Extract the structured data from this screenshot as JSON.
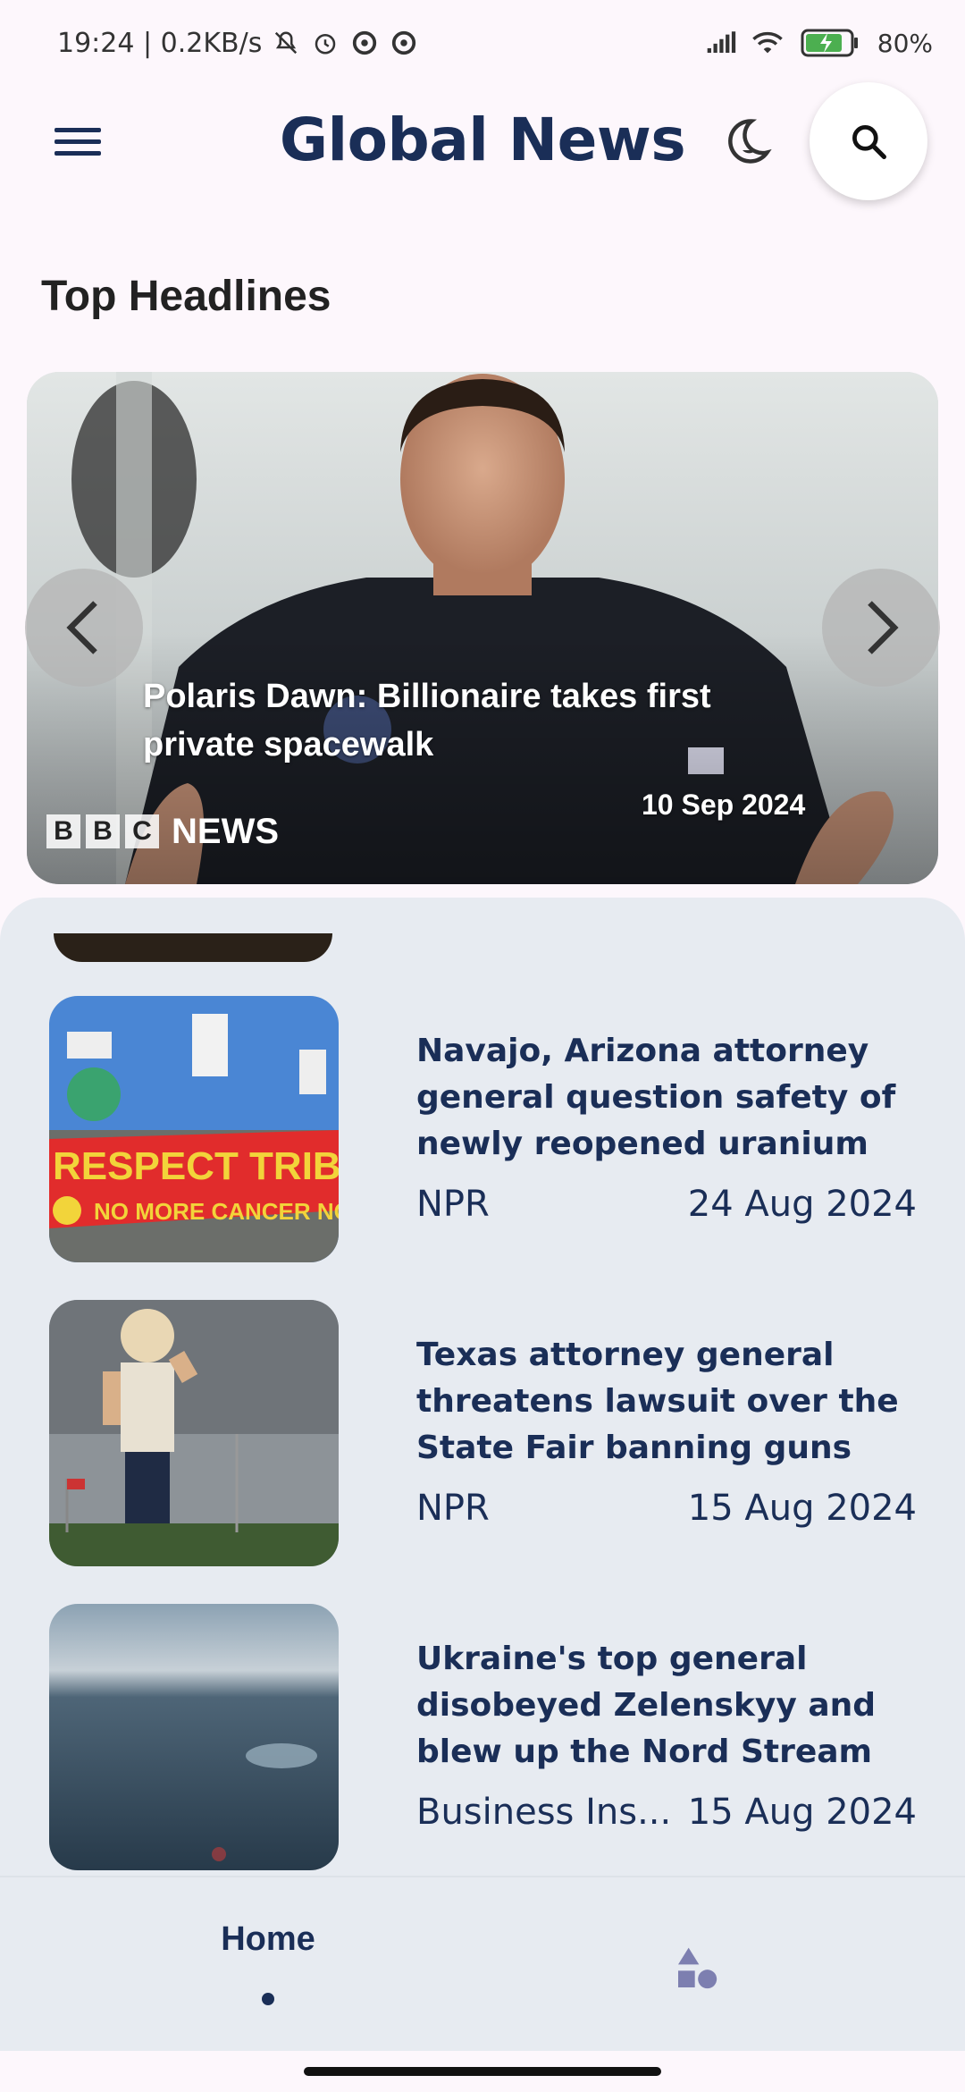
{
  "status_bar": {
    "time_speed": "19:24 | 0.2KB/s",
    "battery": "80%"
  },
  "app_bar": {
    "title": "Global News"
  },
  "section": {
    "title": "Top Headlines"
  },
  "carousel": {
    "headline": "Polaris Dawn: Billionaire takes first private spacewalk",
    "source_letters": [
      "B",
      "B",
      "C"
    ],
    "source_word": "NEWS",
    "date": "10 Sep 2024"
  },
  "articles": [
    {
      "title": "Navajo, Arizona attorney general question safety of newly reopened uranium",
      "source": "NPR",
      "date": "24 Aug 2024",
      "image_sign": "RESPECT TRIBAL SOVE",
      "image_sign2": "NO MORE CANCER NO MORE"
    },
    {
      "title": "Texas attorney general threatens lawsuit over the State Fair banning guns",
      "source": "NPR",
      "date": "15 Aug 2024"
    },
    {
      "title": "Ukraine's top general disobeyed Zelenskyy and blew up the Nord Stream",
      "source": "Business Ins...",
      "date": "15 Aug 2024"
    }
  ],
  "bottom_nav": {
    "home_label": "Home"
  },
  "colors": {
    "primary": "#1a2e57",
    "background": "#fdf7fc",
    "sheet": "#e7ebf1"
  },
  "icons": {
    "menu": "menu-icon",
    "theme": "moon-icon",
    "search": "search-icon",
    "prev": "chevron-left-icon",
    "next": "chevron-right-icon",
    "categories": "shapes-icon"
  }
}
